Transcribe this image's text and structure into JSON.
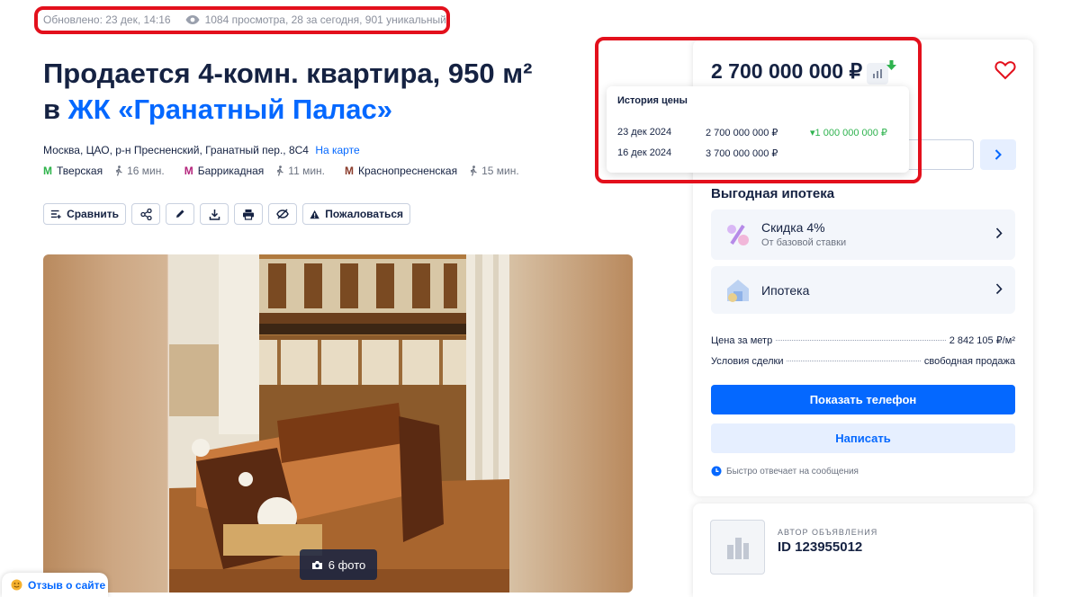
{
  "meta": {
    "updated": "Обновлено: 23 дек, 14:16",
    "views": "1084 просмотра, 28 за сегодня, 901 уникальный"
  },
  "title": {
    "line1": "Продается 4-комн. квартира, 950 м²",
    "prefix": "в ",
    "complex": "ЖК «Гранатный Палас»"
  },
  "address": {
    "text": "Москва, ЦАО, р-н Пресненский, Гранатный пер., 8С4",
    "map_link": "На карте"
  },
  "metro": [
    {
      "name": "Тверская",
      "time": "16 мин.",
      "color": "#2db34a"
    },
    {
      "name": "Баррикадная",
      "time": "11 мин.",
      "color": "#b4247c"
    },
    {
      "name": "Краснопресненская",
      "time": "15 мин.",
      "color": "#8a3b2b"
    }
  ],
  "actions": {
    "compare": "Сравнить",
    "report": "Пожаловаться"
  },
  "photo": {
    "count": "6 фото"
  },
  "feedback": "Отзыв о сайте",
  "price": {
    "value": "2 700 000 000 ₽"
  },
  "history": {
    "title": "История цены",
    "rows": [
      {
        "date": "23 дек 2024",
        "price": "2 700 000 000 ₽",
        "diff": "1 000 000 000 ₽"
      },
      {
        "date": "16 дек 2024",
        "price": "3 700 000 000 ₽",
        "diff": ""
      }
    ]
  },
  "mortgage": {
    "title": "Выгодная ипотека",
    "discount_title": "Скидка 4%",
    "discount_sub": "От базовой ставки",
    "mortgage_label": "Ипотека"
  },
  "details": [
    {
      "label": "Цена за метр",
      "value": "2 842 105 ₽/м²"
    },
    {
      "label": "Условия сделки",
      "value": "свободная продажа"
    }
  ],
  "buttons": {
    "phone": "Показать телефон",
    "write": "Написать"
  },
  "fast_reply": "Быстро отвечает на сообщения",
  "author": {
    "label": "АВТОР ОБЪЯВЛЕНИЯ",
    "id": "ID 123955012"
  },
  "colors": {
    "accent": "#0468ff",
    "highlight": "#e3101c",
    "positive": "#2fb34f"
  }
}
